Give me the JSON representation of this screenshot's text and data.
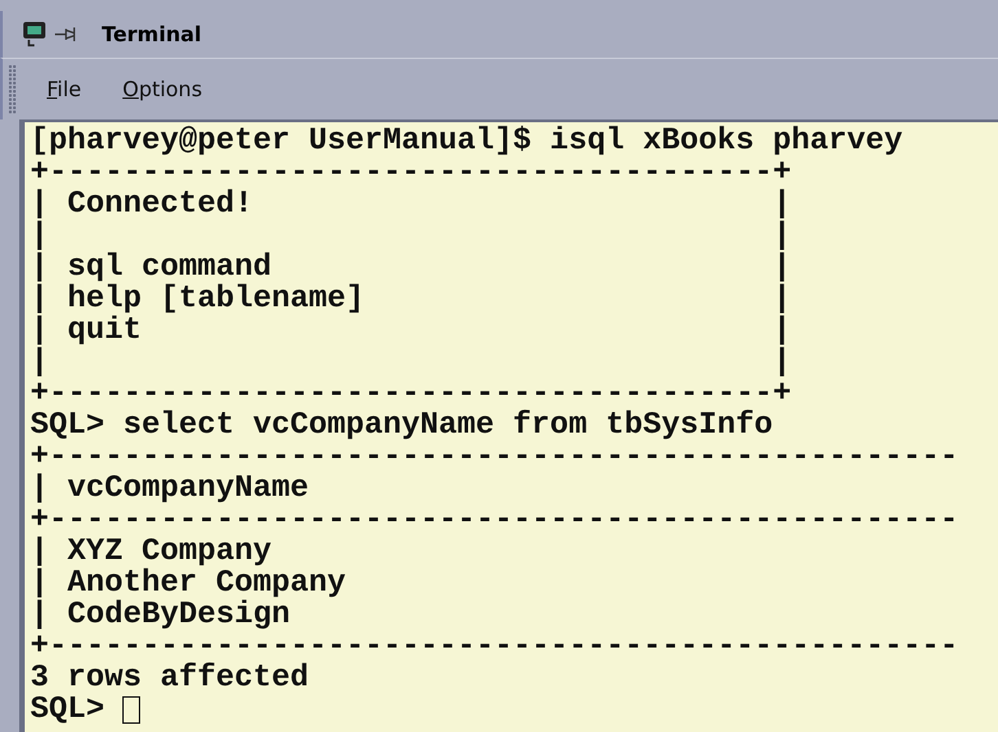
{
  "window": {
    "title": "Terminal"
  },
  "menu": [
    {
      "accel": "F",
      "rest": "ile"
    },
    {
      "accel": "O",
      "rest": "ptions"
    }
  ],
  "terminal": {
    "lines": [
      "[pharvey@peter UserManual]$ isql xBooks pharvey",
      "+---------------------------------------+",
      "| Connected!                            |",
      "|                                       |",
      "| sql command                           |",
      "| help [tablename]                      |",
      "| quit                                  |",
      "|                                       |",
      "+---------------------------------------+",
      "SQL> select vcCompanyName from tbSysInfo",
      "+-------------------------------------------------",
      "| vcCompanyName",
      "+-------------------------------------------------",
      "| XYZ Company",
      "| Another Company",
      "| CodeByDesign",
      "+-------------------------------------------------",
      "3 rows affected"
    ],
    "prompt": "SQL>"
  }
}
